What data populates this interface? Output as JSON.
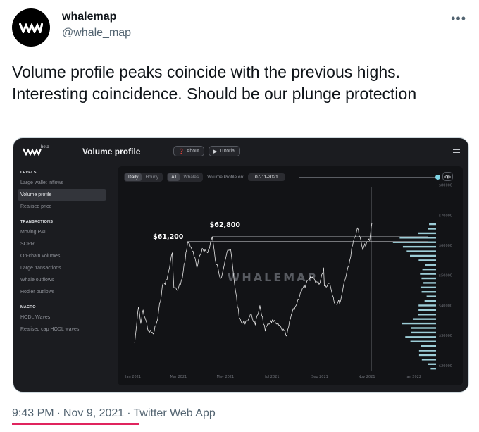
{
  "author": {
    "name": "whalemap",
    "handle": "@whale_map"
  },
  "tweet": {
    "text": "Volume profile peaks coincide with the previous highs. Interesting coincidence. Should be our plunge protection",
    "time": "9:43 PM",
    "date": "Nov 9, 2021",
    "separator": "·",
    "source": "Twitter Web App"
  },
  "app": {
    "beta": "beta",
    "title": "Volume profile",
    "about_label": "About",
    "tutorial_label": "Tutorial",
    "sidebar": [
      {
        "section": "LEVELS",
        "items": [
          {
            "label": "Large wallet inflows",
            "active": false
          },
          {
            "label": "Volume profile",
            "active": true
          },
          {
            "label": "Realised price",
            "active": false
          }
        ]
      },
      {
        "section": "TRANSACTIONS",
        "items": [
          {
            "label": "Moving P&L",
            "active": false
          },
          {
            "label": "SOPR",
            "active": false
          },
          {
            "label": "On-chain volumes",
            "active": false
          },
          {
            "label": "Large transactions",
            "active": false
          },
          {
            "label": "Whale outflows",
            "active": false
          },
          {
            "label": "Hodler outflows",
            "active": false
          }
        ]
      },
      {
        "section": "MACRO",
        "items": [
          {
            "label": "HODL Waves",
            "active": false
          },
          {
            "label": "Realised cap HODL waves",
            "active": false
          }
        ]
      }
    ],
    "controls": {
      "range_options": [
        "Daily",
        "Hourly"
      ],
      "range_selected": "Daily",
      "scope_options": [
        "All",
        "Whales"
      ],
      "scope_selected": "All",
      "vp_label": "Volume Profile on:",
      "vp_date": "07-11-2021"
    },
    "watermark": "WHALEMAP",
    "colors": {
      "line": "#e8e8e8",
      "profile": "#a8dde8",
      "slider": "#7fd4e4",
      "background": "#1b1c20"
    }
  },
  "chart_data": {
    "type": "line",
    "x_ticks": [
      "Jan 2021",
      "Mar 2021",
      "May 2021",
      "Jul 2021",
      "Sep 2021",
      "Nov 2021",
      "Jan 2022"
    ],
    "y_ticks": [
      "$20000",
      "$30000",
      "$40000",
      "$50000",
      "$60000",
      "$70000",
      "$80000"
    ],
    "ylim": [
      16000,
      82000
    ],
    "series": [
      {
        "points": [
          [
            "2021-01-03",
            27500
          ],
          [
            "2021-01-08",
            39500
          ],
          [
            "2021-01-11",
            34000
          ],
          [
            "2021-01-14",
            38500
          ],
          [
            "2021-01-21",
            31500
          ],
          [
            "2021-01-27",
            30500
          ],
          [
            "2021-02-02",
            35500
          ],
          [
            "2021-02-08",
            46500
          ],
          [
            "2021-02-14",
            48500
          ],
          [
            "2021-02-21",
            57500
          ],
          [
            "2021-02-23",
            46000
          ],
          [
            "2021-02-28",
            45000
          ],
          [
            "2021-03-06",
            49000
          ],
          [
            "2021-03-13",
            61200
          ],
          [
            "2021-03-20",
            58000
          ],
          [
            "2021-03-25",
            52500
          ],
          [
            "2021-04-01",
            59000
          ],
          [
            "2021-04-08",
            57500
          ],
          [
            "2021-04-14",
            62800
          ],
          [
            "2021-04-18",
            55000
          ],
          [
            "2021-04-25",
            49000
          ],
          [
            "2021-05-03",
            57500
          ],
          [
            "2021-05-08",
            58500
          ],
          [
            "2021-05-12",
            49500
          ],
          [
            "2021-05-19",
            36000
          ],
          [
            "2021-05-23",
            34000
          ],
          [
            "2021-05-29",
            35000
          ],
          [
            "2021-06-04",
            37000
          ],
          [
            "2021-06-09",
            33500
          ],
          [
            "2021-06-15",
            40000
          ],
          [
            "2021-06-22",
            31500
          ],
          [
            "2021-06-29",
            35000
          ],
          [
            "2021-07-06",
            34000
          ],
          [
            "2021-07-13",
            32500
          ],
          [
            "2021-07-20",
            29800
          ],
          [
            "2021-07-26",
            37000
          ],
          [
            "2021-08-01",
            40000
          ],
          [
            "2021-08-07",
            44500
          ],
          [
            "2021-08-14",
            47000
          ],
          [
            "2021-08-22",
            49500
          ],
          [
            "2021-08-31",
            47000
          ],
          [
            "2021-09-06",
            52500
          ],
          [
            "2021-09-07",
            46500
          ],
          [
            "2021-09-14",
            47500
          ],
          [
            "2021-09-21",
            40500
          ],
          [
            "2021-09-28",
            41500
          ],
          [
            "2021-10-03",
            48000
          ],
          [
            "2021-10-10",
            55000
          ],
          [
            "2021-10-15",
            61500
          ],
          [
            "2021-10-20",
            65800
          ],
          [
            "2021-10-27",
            58500
          ],
          [
            "2021-11-01",
            61000
          ],
          [
            "2021-11-05",
            61500
          ],
          [
            "2021-11-08",
            67500
          ]
        ]
      }
    ],
    "annotations": [
      {
        "label": "$61,200",
        "value": 61200
      },
      {
        "label": "$62,800",
        "value": 62800
      }
    ],
    "volume_profile": [
      [
        19000,
        0.15
      ],
      [
        20500,
        0.25
      ],
      [
        22000,
        0.3
      ],
      [
        23500,
        0.35
      ],
      [
        25000,
        0.45
      ],
      [
        26500,
        0.4
      ],
      [
        28000,
        0.55
      ],
      [
        29500,
        0.7
      ],
      [
        31000,
        0.65
      ],
      [
        32500,
        0.6
      ],
      [
        34000,
        0.75
      ],
      [
        35500,
        0.55
      ],
      [
        37000,
        0.5
      ],
      [
        38500,
        0.4
      ],
      [
        40000,
        0.35
      ],
      [
        41500,
        0.3
      ],
      [
        43000,
        0.28
      ],
      [
        44500,
        0.3
      ],
      [
        46000,
        0.32
      ],
      [
        47500,
        0.35
      ],
      [
        49000,
        0.38
      ],
      [
        50500,
        0.32
      ],
      [
        52000,
        0.3
      ],
      [
        53500,
        0.33
      ],
      [
        55000,
        0.42
      ],
      [
        56500,
        0.55
      ],
      [
        58000,
        0.7
      ],
      [
        59500,
        0.85
      ],
      [
        61000,
        1.0
      ],
      [
        62500,
        0.8
      ],
      [
        64000,
        0.45
      ],
      [
        65500,
        0.25
      ],
      [
        67000,
        0.12
      ]
    ]
  }
}
